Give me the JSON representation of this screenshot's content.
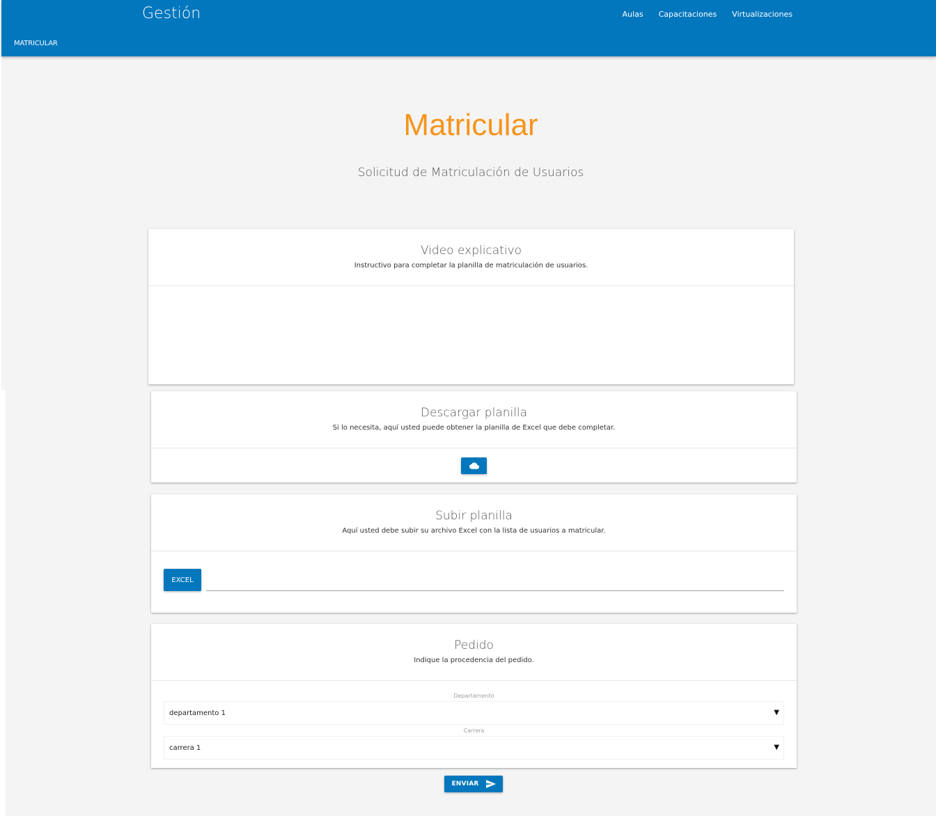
{
  "navbar": {
    "brand": "Gestión",
    "links": [
      "Aulas",
      "Capacitaciones",
      "Virtualizaciones"
    ],
    "subnav": "MATRICULAR",
    "color": "#0277bd"
  },
  "page": {
    "title": "Matricular",
    "subtitle": "Solicitud de Matriculación de Usuarios",
    "title_color": "#f7941d"
  },
  "video_card": {
    "title": "Video explicativo",
    "description": "Instructivo para completar la planilla de matriculación de usuarios."
  },
  "download_card": {
    "title": "Descargar planilla",
    "description": "Si lo necesita, aquí usted puede obtener la planilla de Excel que debe completar.",
    "button_icon": "cloud-download-icon"
  },
  "upload_card": {
    "title": "Subir planilla",
    "description": "Aquí usted debe subir su archivo Excel con la lista de usuarios a matricular.",
    "button_label": "EXCEL",
    "file_value": ""
  },
  "order_card": {
    "title": "Pedido",
    "description": "Indique la procedencia del pedido.",
    "department_label": "Departamento",
    "department_value": "departamento 1",
    "career_label": "Carrera",
    "career_value": "carrera 1"
  },
  "submit": {
    "label": "ENVIAR",
    "icon": "send-icon"
  }
}
